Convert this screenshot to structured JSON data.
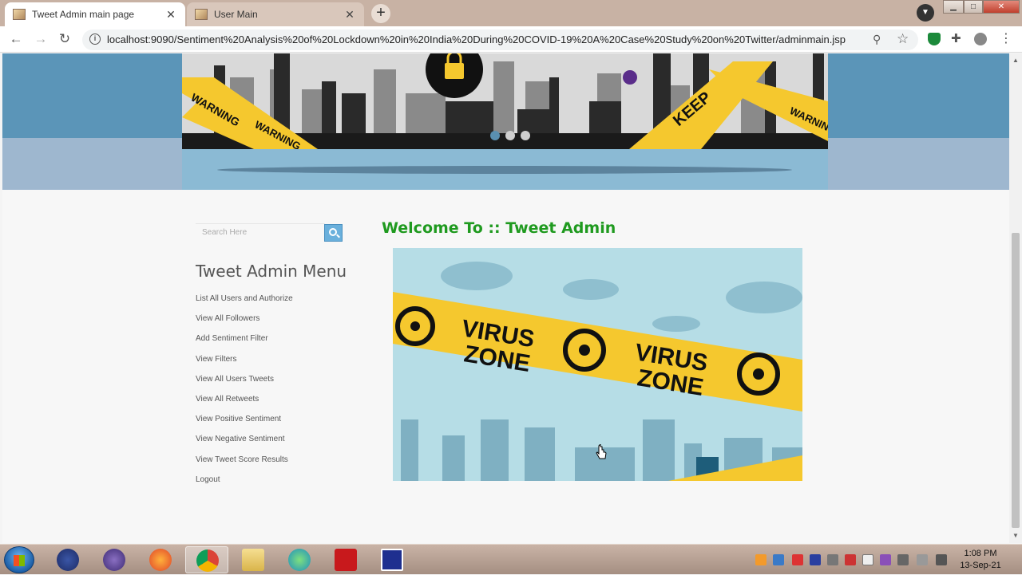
{
  "browser": {
    "tabs": [
      {
        "title": "Tweet Admin main page",
        "active": true
      },
      {
        "title": "User Main",
        "active": false
      }
    ],
    "new_tab_symbol": "+",
    "close_symbol": "✕",
    "address": "localhost:9090/Sentiment%20Analysis%20of%20Lockdown%20in%20India%20During%20COVID-19%20A%20Case%20Study%20on%20Twitter/adminmain.jsp",
    "nav": {
      "back": "←",
      "forward": "→",
      "reload": "↻"
    },
    "window_controls": {
      "min": "▁",
      "max": "□",
      "close": "✕"
    }
  },
  "sidebar": {
    "search_placeholder": "Search Here",
    "menu_title": "Tweet Admin Menu",
    "items": [
      "List All Users and Authorize",
      "View All Followers",
      "Add Sentiment Filter",
      "View Filters",
      "View All Users Tweets",
      "View All Retweets",
      "View Positive Sentiment",
      "View Negative Sentiment",
      "View Tweet Score Results",
      "Logout"
    ]
  },
  "main": {
    "welcome": "Welcome To :: Tweet Admin",
    "banner_words": [
      "WARNING",
      "WARNING",
      "KEEP",
      "WARNING"
    ],
    "hero_text": [
      "VIRUS",
      "ZONE",
      "VIRUS",
      "ZONE"
    ]
  },
  "taskbar": {
    "time": "1:08 PM",
    "date": "13-Sep-21"
  },
  "colors": {
    "welcome_green": "#1f9a1f",
    "header_blue": "#5b95b8",
    "search_button": "#6ab0dc",
    "hazard_yellow": "#f5c82e"
  },
  "icons": [
    "back-icon",
    "forward-icon",
    "reload-icon",
    "info-icon",
    "zoom-icon",
    "star-icon",
    "extension-icon",
    "account-icon",
    "menu-icon",
    "search-icon",
    "windows-start-icon"
  ]
}
